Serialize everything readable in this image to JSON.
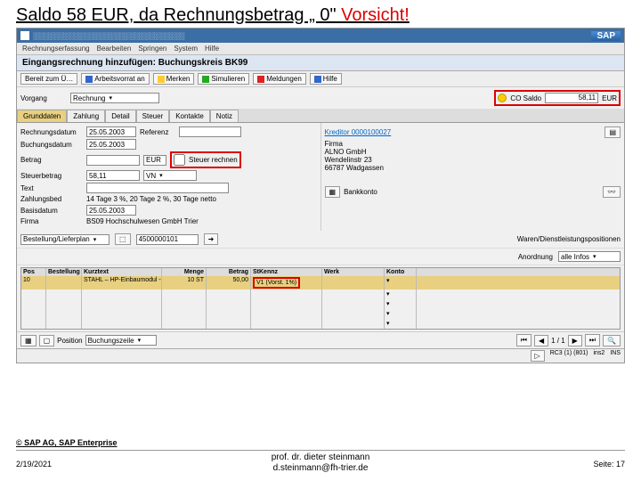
{
  "slide": {
    "title_a": "Saldo 58 EUR, da Rechnungsbetrag „ 0\" ",
    "title_b": "Vorsicht!"
  },
  "window": {
    "title": "Rechnungserfassung  Bearbeiten  Springen  System  Hilfe",
    "logo": "SAP"
  },
  "menubar": [
    "Rechnungserfassung",
    "Bearbeiten",
    "Springen",
    "System",
    "Hilfe"
  ],
  "subtitle": "Eingangsrechnung hinzufügen: Buchungskreis BK99",
  "toolbar": {
    "b1": "Bereit zum Ü…",
    "b2": "Arbeitsvorrat an",
    "b3": "Merken",
    "b4": "Simulieren",
    "b5": "Meldungen",
    "b6": "Hilfe"
  },
  "vorgang": {
    "label": "Vorgang",
    "value": "Rechnung"
  },
  "balance": {
    "icon": "yellow",
    "label": "CO Saldo",
    "value": "58,11",
    "curr": "EUR"
  },
  "tabs": [
    "Grunddaten",
    "Zahlung",
    "Detail",
    "Steuer",
    "Kontakte",
    "Notiz"
  ],
  "left": {
    "rows": [
      {
        "l": "Rechnungsdatum",
        "v": "25.05.2003",
        "l2": "Referenz",
        "v2": ""
      },
      {
        "l": "Buchungsdatum",
        "v": "25.05.2003"
      },
      {
        "l": "Betrag",
        "v": "",
        "c": "EUR",
        "cb": "Steuer rechnen"
      },
      {
        "l": "Steuerbetrag",
        "v": "58,11",
        "sel": "VN"
      },
      {
        "l": "Text",
        "v": ""
      },
      {
        "l": "Zahlungsbed",
        "v": "14 Tage 3 %, 20 Tage 2 %, 30 Tage netto"
      },
      {
        "l": "Basisdatum",
        "v": "25.05.2003"
      },
      {
        "l": "Firma",
        "v": "BS09 Hochschulwesen GmbH Trier"
      }
    ]
  },
  "right": {
    "header": "Kreditor 0000100027",
    "lines": [
      "Firma",
      "ALNO GmbH",
      "Wendelinstr 23",
      "66787 Wadgassen"
    ],
    "bank": "Bankkonto"
  },
  "mid": {
    "label": "Bestellung/Lieferplan",
    "po": "4500000101",
    "r": "Waren/Dienstleistungspositionen",
    "layout": "alle Infos"
  },
  "grid": {
    "headers": [
      "Pos",
      "Bestellung",
      "Kurztext",
      "Menge",
      "Betrag",
      "StKennz",
      "Werk",
      "Konto"
    ],
    "row": {
      "pos": "10",
      "best": "",
      "txt": "STAHL – HP-Einbaumodul - N",
      "menge": "10 ST",
      "betrag": "50,00",
      "st": "V1 (Vorst. 1%)",
      "werk": "",
      "konto": ""
    }
  },
  "pager": {
    "label": "Position",
    "sort": "Buchungszeile",
    "pg": "1 / 1"
  },
  "status": {
    "sys": "RC3 (1) (801)",
    "srv": "ins2",
    "mode": "INS"
  },
  "footer": {
    "copy": "© SAP AG, SAP Enterprise",
    "date": "2/19/2021",
    "author1": "prof. dr. dieter steinmann",
    "author2": "d.steinmann@fh-trier.de",
    "page": "Seite: 17"
  }
}
